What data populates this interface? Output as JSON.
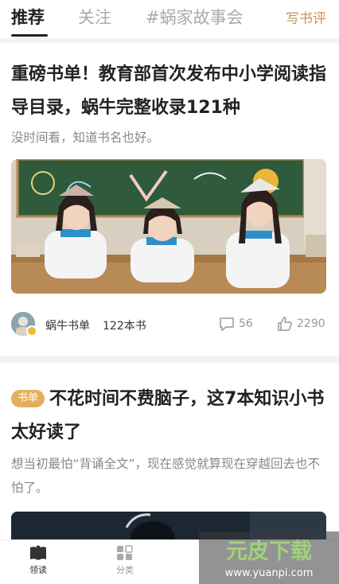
{
  "tabs": {
    "recommend": "推荐",
    "follow": "关注",
    "story": "#蜗家故事会",
    "write_review": "写书评"
  },
  "article1": {
    "title": "重磅书单！教育部首次发布中小学阅读指导目录，蜗牛完整收录121种",
    "subtitle": "没时间看，知道书名也好。",
    "image_icon": "students-with-books-photo",
    "author": "蜗牛书单",
    "book_count": "122本书",
    "comments": "56",
    "likes": "2290"
  },
  "article2": {
    "tag": "书单",
    "title": "不花时间不费脑子，这7本知识小书太好读了",
    "subtitle": "想当初最怕“背诵全文”，现在感觉就算现在穿越回去也不怕了。",
    "image_icon": "dark-photo"
  },
  "bottom_nav": {
    "items": [
      {
        "label": "领读",
        "icon": "book-reading-icon",
        "active": true
      },
      {
        "label": "分类",
        "icon": "category-grid-icon",
        "active": false
      }
    ]
  },
  "watermark": {
    "brand": "元皮下载",
    "url": "www.yuanpi.com"
  },
  "colors": {
    "accent": "#c8954e",
    "tag": "#e4ae5b",
    "text": "#222222",
    "muted": "#888888"
  }
}
